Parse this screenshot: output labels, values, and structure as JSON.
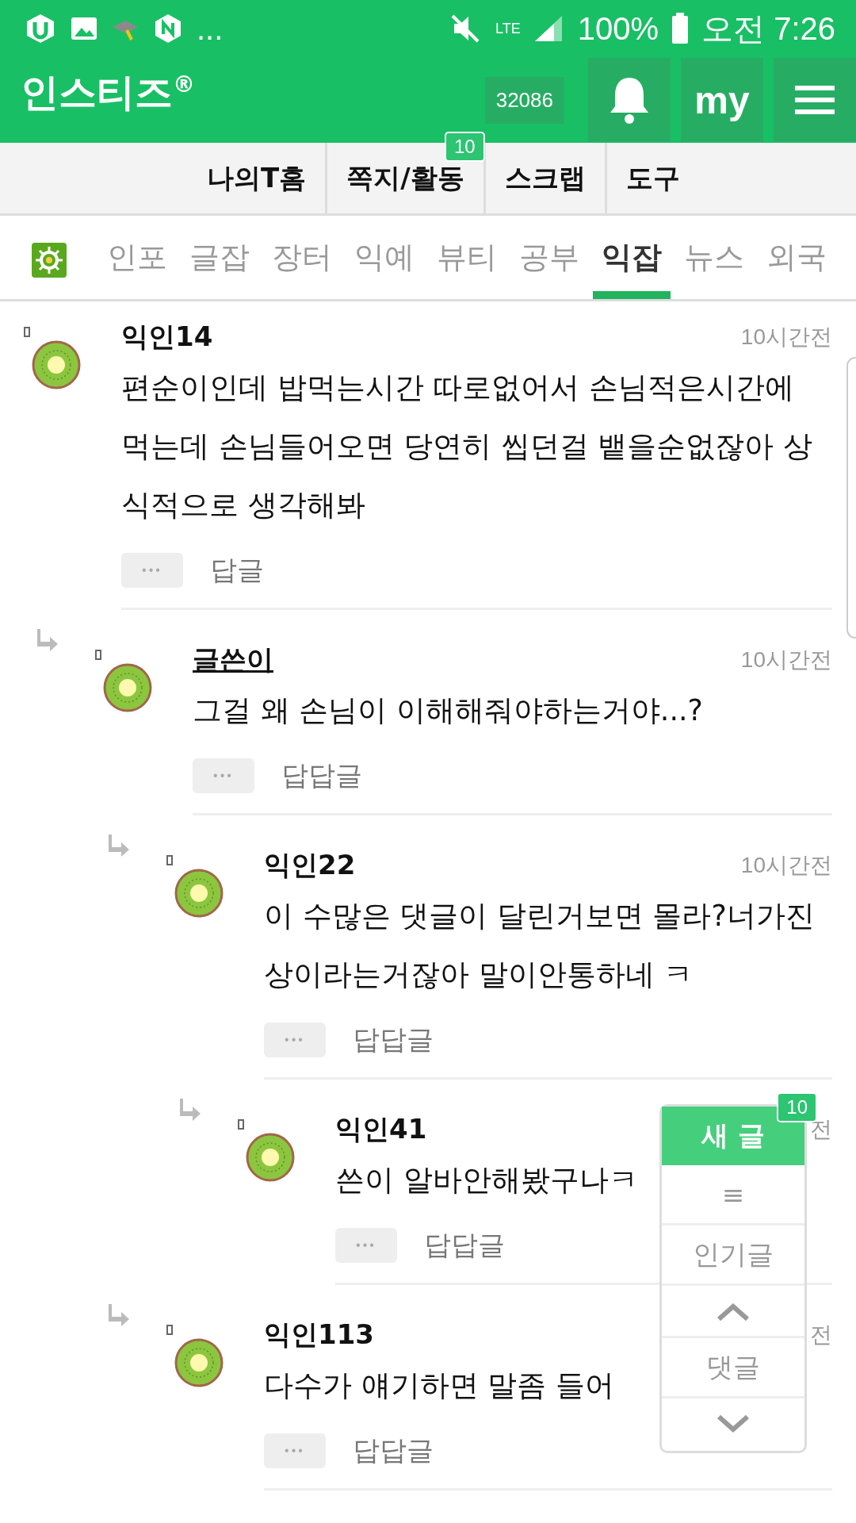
{
  "status_bar": {
    "more": "...",
    "network": "LTE",
    "battery": "100%",
    "time": "오전 7:26"
  },
  "header": {
    "logo": "인스티즈$^{®}$",
    "points": "32086",
    "my": "my"
  },
  "top_nav": [
    {
      "label": "나의T홈"
    },
    {
      "label": "쪽지/활동",
      "badge": "10"
    },
    {
      "label": "스크랩"
    },
    {
      "label": "도구"
    }
  ],
  "categories": [
    {
      "label": "인포",
      "selected": false
    },
    {
      "label": "글잡",
      "selected": false
    },
    {
      "label": "장터",
      "selected": false
    },
    {
      "label": "익예",
      "selected": false
    },
    {
      "label": "뷰티",
      "selected": false
    },
    {
      "label": "공부",
      "selected": false
    },
    {
      "label": "익잡",
      "selected": true
    },
    {
      "label": "뉴스",
      "selected": false
    },
    {
      "label": "외국",
      "selected": false
    }
  ],
  "comments": [
    {
      "author": "익인14",
      "is_writer": false,
      "time": "10시간전",
      "body": "편순이인데 밥먹는시간 따로없어서 손님적은시간에 먹는데 손님들어오면 당연히 씹던걸 뱉을순없잖아 상식적으로 생각해봐",
      "more": "•••",
      "reply": "답글",
      "children": [
        {
          "author": "글쓴이",
          "is_writer": true,
          "time": "10시간전",
          "body": "그걸 왜 손님이 이해해줘야하는거야...?",
          "more": "•••",
          "reply": "답답글",
          "children": [
            {
              "author": "익인22",
              "is_writer": false,
              "time": "10시간전",
              "body": "이 수많은 댓글이 달린거보면 몰라?너가진상이라는거잖아 말이안통하네 ㅋ",
              "more": "•••",
              "reply": "답답글",
              "children": [
                {
                  "author": "익인41",
                  "is_writer": false,
                  "time": "전",
                  "body": "쓴이 알바안해봤구나ㅋ",
                  "more": "•••",
                  "reply": "답답글"
                }
              ]
            },
            {
              "author": "익인113",
              "is_writer": false,
              "time": "전",
              "body": "다수가 얘기하면 말좀 들어",
              "more": "•••",
              "reply": "답답글"
            }
          ]
        }
      ]
    }
  ],
  "float_panel": {
    "new_post": "새 글",
    "badge": "10",
    "menu": "≡",
    "popular": "인기글",
    "comments": "댓글"
  }
}
